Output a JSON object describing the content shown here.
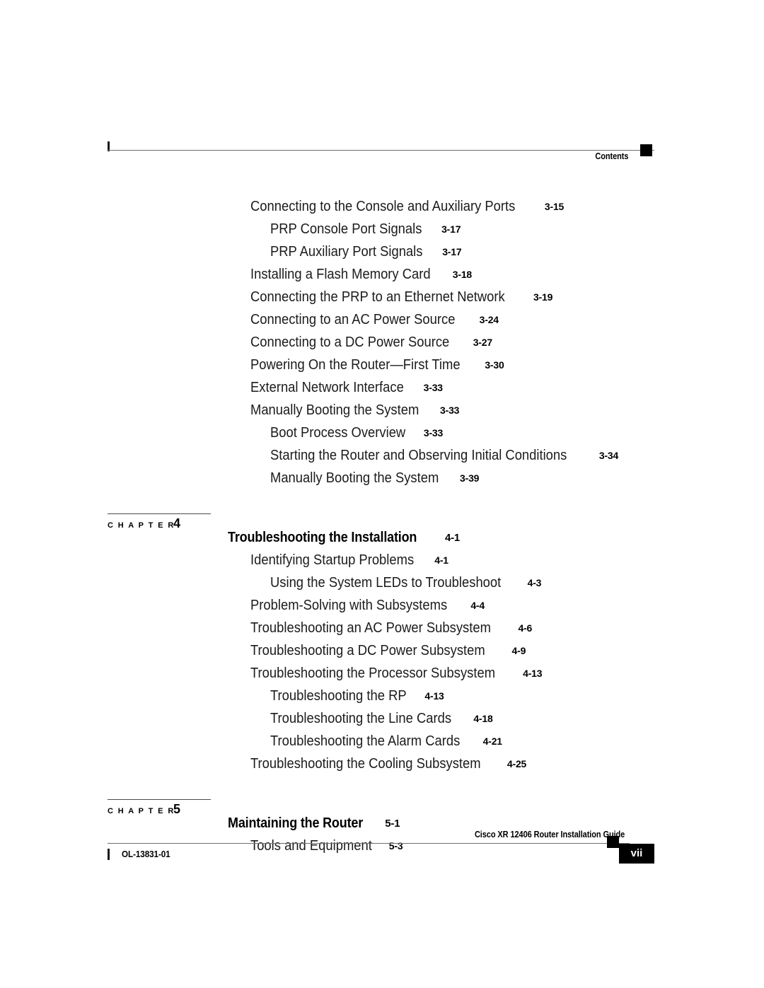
{
  "header": {
    "title": "Contents",
    "marker_icon": "black-square-marker"
  },
  "document": {
    "footer_guide_title": "Cisco XR 12406 Router Installation Guide",
    "footer_doc_number": "OL-13831-01",
    "footer_page_number": "vii"
  },
  "toc": {
    "chapter_label": "C H A P T E R",
    "sections": [
      {
        "entries": [
          {
            "level": 1,
            "title": "Connecting to the Console and Auxiliary Ports",
            "page": "3-15"
          },
          {
            "level": 2,
            "title": "PRP Console Port Signals",
            "page": "3-17"
          },
          {
            "level": 2,
            "title": "PRP Auxiliary Port Signals",
            "page": "3-17"
          },
          {
            "level": 1,
            "title": "Installing a Flash Memory Card",
            "page": "3-18"
          },
          {
            "level": 1,
            "title": "Connecting the PRP to an Ethernet Network",
            "page": "3-19"
          },
          {
            "level": 1,
            "title": "Connecting to an AC Power Source",
            "page": "3-24"
          },
          {
            "level": 1,
            "title": "Connecting to a DC Power Source",
            "page": "3-27"
          },
          {
            "level": 1,
            "title": "Powering On the Router—First Time",
            "page": "3-30"
          },
          {
            "level": 1,
            "title": "External Network Interface",
            "page": "3-33"
          },
          {
            "level": 1,
            "title": "Manually Booting the System",
            "page": "3-33"
          },
          {
            "level": 2,
            "title": "Boot Process Overview",
            "page": "3-33"
          },
          {
            "level": 2,
            "title": "Starting the Router and Observing Initial Conditions",
            "page": "3-34"
          },
          {
            "level": 2,
            "title": "Manually Booting the System",
            "page": "3-39"
          }
        ]
      }
    ],
    "chapters": [
      {
        "number": "4",
        "title": "Troubleshooting the Installation",
        "page": "4-1",
        "entries": [
          {
            "level": 1,
            "title": "Identifying Startup Problems",
            "page": "4-1"
          },
          {
            "level": 2,
            "title": "Using the System LEDs to Troubleshoot",
            "page": "4-3"
          },
          {
            "level": 1,
            "title": "Problem-Solving with Subsystems",
            "page": "4-4"
          },
          {
            "level": 1,
            "title": "Troubleshooting an AC Power Subsystem",
            "page": "4-6"
          },
          {
            "level": 1,
            "title": "Troubleshooting a DC Power Subsystem",
            "page": "4-9"
          },
          {
            "level": 1,
            "title": "Troubleshooting the Processor Subsystem",
            "page": "4-13"
          },
          {
            "level": 2,
            "title": "Troubleshooting the RP",
            "page": "4-13"
          },
          {
            "level": 2,
            "title": "Troubleshooting the Line Cards",
            "page": "4-18"
          },
          {
            "level": 2,
            "title": "Troubleshooting the Alarm Cards",
            "page": "4-21"
          },
          {
            "level": 1,
            "title": "Troubleshooting the Cooling Subsystem",
            "page": "4-25"
          }
        ]
      },
      {
        "number": "5",
        "title": "Maintaining the Router",
        "page": "5-1",
        "entries": [
          {
            "level": 1,
            "title": "Tools and Equipment",
            "page": "5-3"
          }
        ]
      }
    ]
  }
}
